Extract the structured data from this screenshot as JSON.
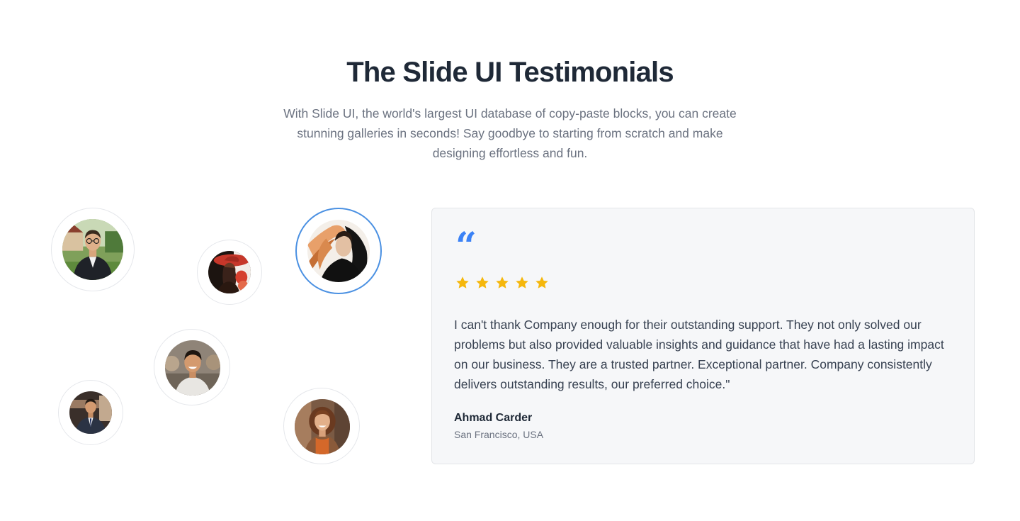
{
  "header": {
    "title": "The Slide UI Testimonials",
    "subtitle": "With Slide UI, the world's largest UI database of copy-paste blocks, you can create stunning galleries in seconds! Say goodbye to starting from scratch and make designing effortless and fun."
  },
  "avatars": [
    {
      "name": "avatar-man-glasses-suit",
      "active": false
    },
    {
      "name": "avatar-woman-red-hat",
      "active": false
    },
    {
      "name": "avatar-woman-flowing-hair",
      "active": true
    },
    {
      "name": "avatar-man-smiling",
      "active": false
    },
    {
      "name": "avatar-man-suit",
      "active": false
    },
    {
      "name": "avatar-woman-curly-hair",
      "active": false
    }
  ],
  "testimonial": {
    "quote_icon": "“",
    "rating": 5,
    "rating_max": 5,
    "text": "I can't thank Company enough for their outstanding support. They not only solved our problems but also provided valuable insights and guidance that have had a lasting impact on our business. They are a trusted partner. Exceptional partner. Company consistently delivers outstanding results, our preferred choice.\"",
    "author_name": "Ahmad Carder",
    "author_location": "San Francisco, USA"
  },
  "colors": {
    "accent": "#4a90e2",
    "quote": "#3b82f6",
    "star": "#f5b70c",
    "card_bg": "#f6f7f9"
  }
}
